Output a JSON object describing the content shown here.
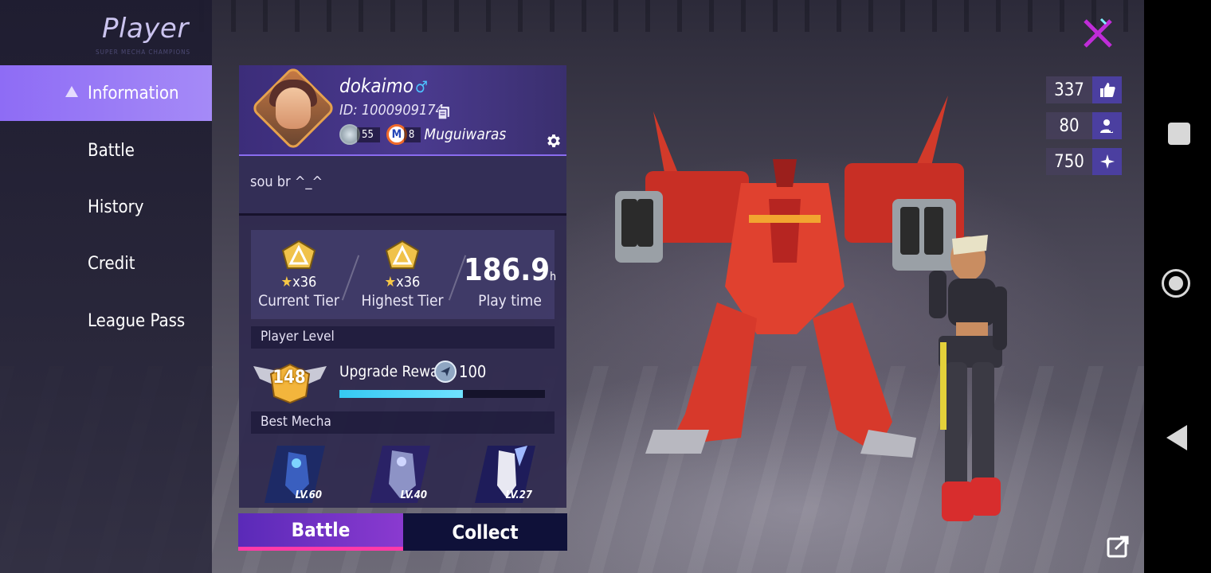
{
  "page": {
    "title": "Player",
    "subtitle": "SUPER MECHA CHAMPIONS"
  },
  "menu": {
    "items": [
      {
        "label": "Information",
        "active": true
      },
      {
        "label": "Battle",
        "active": false
      },
      {
        "label": "History",
        "active": false
      },
      {
        "label": "Credit",
        "active": false
      },
      {
        "label": "League Pass",
        "active": false
      }
    ]
  },
  "profile": {
    "username": "dokaimo",
    "gender_symbol": "♂",
    "id": "ID: 1000909174",
    "rank_badge_count": "55",
    "guild_badge_letter": "M",
    "guild_badge_count": "8",
    "guild_name": "Muguiwaras",
    "bio": "sou br ^_^"
  },
  "stats": {
    "current_tier": {
      "stars": "x36",
      "label": "Current Tier"
    },
    "highest_tier": {
      "stars": "x36",
      "label": "Highest Tier"
    },
    "play_time": {
      "value": "186.9",
      "unit": "h",
      "label": "Play time"
    }
  },
  "player_level": {
    "section_label": "Player Level",
    "level": "148",
    "reward_label": "Upgrade Reward",
    "reward_value": "100",
    "progress_fraction": 0.6
  },
  "best_mecha": {
    "section_label": "Best Mecha",
    "items": [
      {
        "level": "LV.60",
        "color": "#3a5fbf"
      },
      {
        "level": "LV.40",
        "color": "#4f4aa8"
      },
      {
        "level": "LV.27",
        "color": "#3b3a9a"
      }
    ]
  },
  "tabs": [
    {
      "label": "Battle",
      "active": true
    },
    {
      "label": "Collect",
      "active": false
    }
  ],
  "counters": [
    {
      "value": "337",
      "icon": "thumbs-up-icon"
    },
    {
      "value": "80",
      "icon": "follower-icon"
    },
    {
      "value": "750",
      "icon": "sparkle-icon"
    }
  ],
  "colors": {
    "accent": "#8e6cf5",
    "tab_active": "#7a35c8",
    "tab_underline": "#ff3aa8",
    "progress": "#35c9f2",
    "close": "#c02cd8"
  }
}
